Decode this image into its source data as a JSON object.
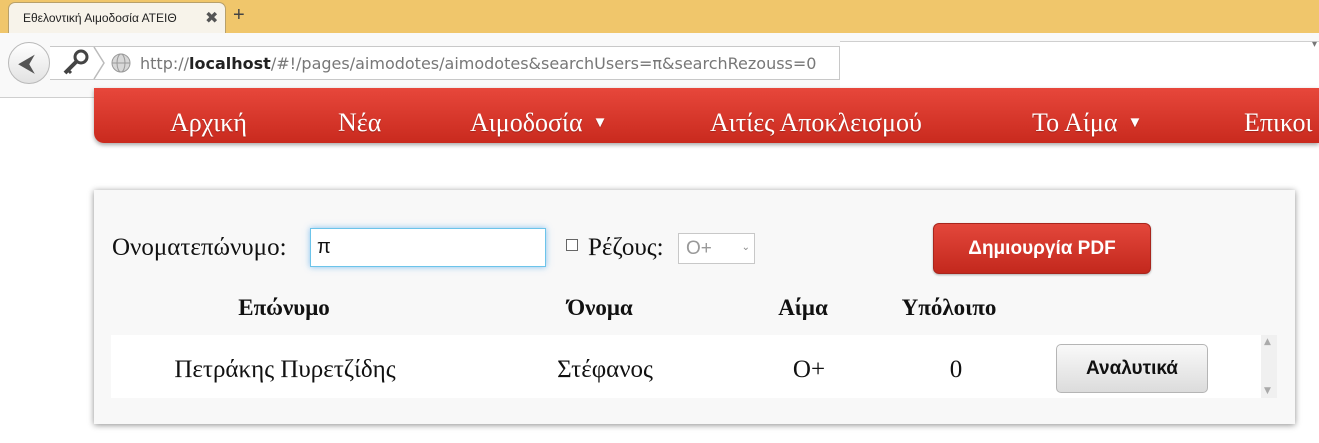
{
  "browser": {
    "tab_title": "Εθελοντική Αιμοδοσία ΑΤΕΙΘ",
    "close_glyph": "✖",
    "new_tab_glyph": "+",
    "url_prefix": "http://",
    "url_host": "localhost",
    "url_path": "/#!/pages/aimodotes/aimodotes&searchUsers=π&searchRezouss=0"
  },
  "nav": {
    "items": [
      {
        "label": "Αρχική",
        "has_dropdown": false
      },
      {
        "label": "Νέα",
        "has_dropdown": false
      },
      {
        "label": "Αιμοδοσία",
        "has_dropdown": true
      },
      {
        "label": "Αιτίες Αποκλεισμού",
        "has_dropdown": false
      },
      {
        "label": "Το Αίμα",
        "has_dropdown": true
      },
      {
        "label": "Επικοι",
        "has_dropdown": false
      }
    ],
    "dropdown_glyph": "▼"
  },
  "search": {
    "name_label": "Ονοματεπώνυμο:",
    "name_value": "π",
    "rezous_label": "Ρέζους:",
    "rezous_checked": false,
    "rezous_value": "O+",
    "pdf_button": "Δημιουργία PDF"
  },
  "table": {
    "headers": [
      "Επώνυμο",
      "Όνομα",
      "Αίμα",
      "Υπόλοιπο"
    ],
    "rows": [
      {
        "surname": "Πετράκης Πυρετζίδης",
        "name": "Στέφανος",
        "blood": "O+",
        "balance": "0",
        "action": "Αναλυτικά"
      }
    ]
  },
  "colors": {
    "tabbar": "#f0c66b",
    "nav_red": "#d8372b",
    "input_focus": "#6cc4ea"
  }
}
